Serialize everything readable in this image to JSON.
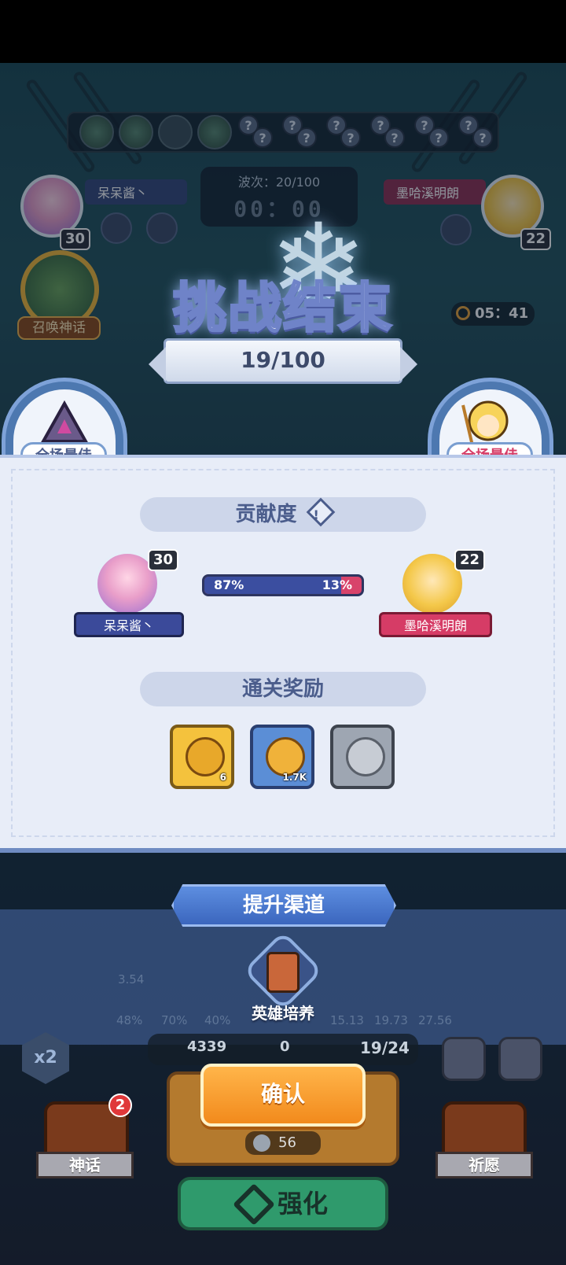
{
  "top_bar": {
    "wave_label": "波次：20/100",
    "wave_timer": "00：00"
  },
  "players": {
    "left": {
      "name": "呆呆酱丶",
      "level": "30"
    },
    "right": {
      "name": "墨哈溪明朗",
      "level": "22"
    }
  },
  "side_menu": {
    "summon_label": "召唤神话"
  },
  "round_timer": "05：41",
  "result": {
    "title": "挑战结束",
    "progress": "19/100"
  },
  "mvp": {
    "left_label": "全场最佳",
    "right_label": "全场最佳"
  },
  "contribution": {
    "heading": "贡献度",
    "left_percent_text": "87%",
    "right_percent_text": "13%",
    "left_fraction": 0.87,
    "left_name": "呆呆酱丶",
    "left_level": "30",
    "right_name": "墨哈溪明朗",
    "right_level": "22"
  },
  "rewards": {
    "heading": "通关奖励",
    "items": [
      {
        "icon": "key-icon",
        "count": "6",
        "color": "#f4c23d"
      },
      {
        "icon": "gold-coin-icon",
        "count": "1.7K",
        "color": "#5b8ed6"
      },
      {
        "icon": "silver-emblem-icon",
        "count": "",
        "color": "#9ea6b2"
      }
    ]
  },
  "upgrade": {
    "heading": "提升渠道",
    "hero_training_label": "英雄培养"
  },
  "bottom_hud": {
    "stats": [
      "3.54",
      "48%",
      "70%",
      "40%",
      "15.13",
      "19.73",
      "27.56"
    ],
    "resource_1": "4339",
    "resource_2": "0",
    "capacity": "19/24",
    "confirm_label": "确认",
    "cost": "56",
    "enhance_label": "强化",
    "myth_label": "神话",
    "myth_badge": "2",
    "wish_label": "祈愿",
    "speed_label": "x2"
  },
  "colors": {
    "left_player_tag": "#3b4a9a",
    "right_player_tag": "#d63c66",
    "confirm_orange": "#f59a2a",
    "panel_bg": "#e8edf8"
  }
}
